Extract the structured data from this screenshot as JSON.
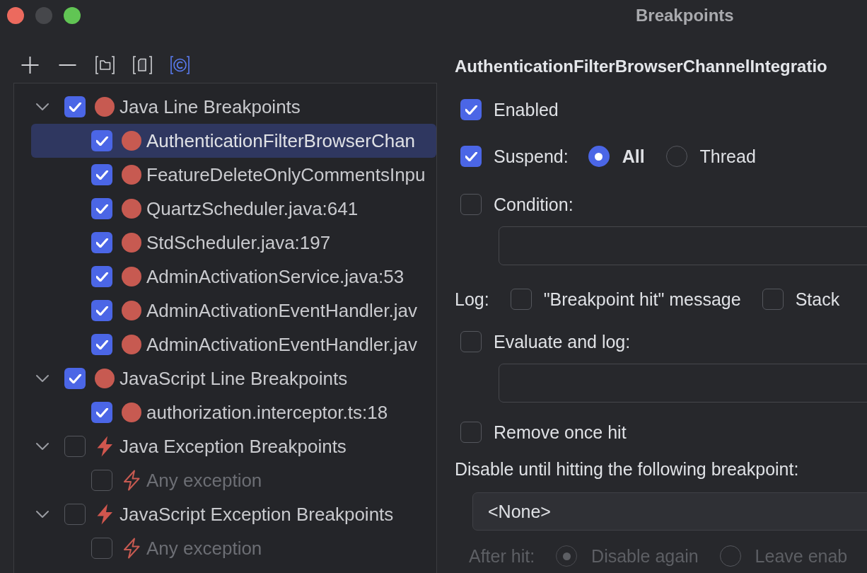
{
  "window": {
    "title": "Breakpoints"
  },
  "toolbar": [
    {
      "kind": "add",
      "selected": false
    },
    {
      "kind": "remove",
      "selected": false
    },
    {
      "kind": "folder",
      "selected": false
    },
    {
      "kind": "file",
      "selected": false
    },
    {
      "kind": "class",
      "selected": true
    }
  ],
  "tree": [
    {
      "label": "Java Line Breakpoints",
      "kind": "line",
      "checked": true,
      "expanded": true,
      "selected": false,
      "children": [
        {
          "label": "AuthenticationFilterBrowserChan",
          "kind": "line",
          "checked": true,
          "selected": true
        },
        {
          "label": "FeatureDeleteOnlyCommentsInpu",
          "kind": "line",
          "checked": true,
          "selected": false
        },
        {
          "label": "QuartzScheduler.java:641",
          "kind": "line",
          "checked": true,
          "selected": false
        },
        {
          "label": "StdScheduler.java:197",
          "kind": "line",
          "checked": true,
          "selected": false
        },
        {
          "label": "AdminActivationService.java:53",
          "kind": "line",
          "checked": true,
          "selected": false
        },
        {
          "label": "AdminActivationEventHandler.jav",
          "kind": "line",
          "checked": true,
          "selected": false
        },
        {
          "label": "AdminActivationEventHandler.jav",
          "kind": "line",
          "checked": true,
          "selected": false
        }
      ]
    },
    {
      "label": "JavaScript Line Breakpoints",
      "kind": "line",
      "checked": true,
      "expanded": true,
      "selected": false,
      "children": [
        {
          "label": "authorization.interceptor.ts:18",
          "kind": "line",
          "checked": true,
          "selected": false
        }
      ]
    },
    {
      "label": "Java Exception Breakpoints",
      "kind": "exception",
      "checked": false,
      "expanded": true,
      "selected": false,
      "children": [
        {
          "label": "Any exception",
          "kind": "exception",
          "checked": false,
          "selected": false
        }
      ]
    },
    {
      "label": "JavaScript Exception Breakpoints",
      "kind": "exception",
      "checked": false,
      "expanded": true,
      "selected": false,
      "children": [
        {
          "label": "Any exception",
          "kind": "exception",
          "checked": false,
          "selected": false
        }
      ]
    }
  ],
  "details": {
    "title": "AuthenticationFilterBrowserChannelIntegratio",
    "enabled": {
      "label": "Enabled",
      "checked": true
    },
    "suspend": {
      "label": "Suspend:",
      "checked": true,
      "options": [
        {
          "label": "All",
          "selected": true,
          "default": true
        },
        {
          "label": "Thread",
          "selected": false,
          "default": false
        }
      ]
    },
    "condition": {
      "label": "Condition:",
      "checked": false
    },
    "log": {
      "label": "Log:",
      "options": [
        {
          "label": "\"Breakpoint hit\" message",
          "checked": false
        },
        {
          "label": "Stack",
          "checked": false
        }
      ]
    },
    "evaluate": {
      "label": "Evaluate and log:",
      "checked": false
    },
    "remove_once_hit": {
      "label": "Remove once hit",
      "checked": false
    },
    "disable_until": {
      "label": "Disable until hitting the following breakpoint:",
      "value": "<None>"
    },
    "after_hit": {
      "label": "After hit:",
      "disabled": true,
      "options": [
        {
          "label": "Disable again",
          "selected": true
        },
        {
          "label": "Leave enab",
          "selected": false
        }
      ]
    }
  }
}
